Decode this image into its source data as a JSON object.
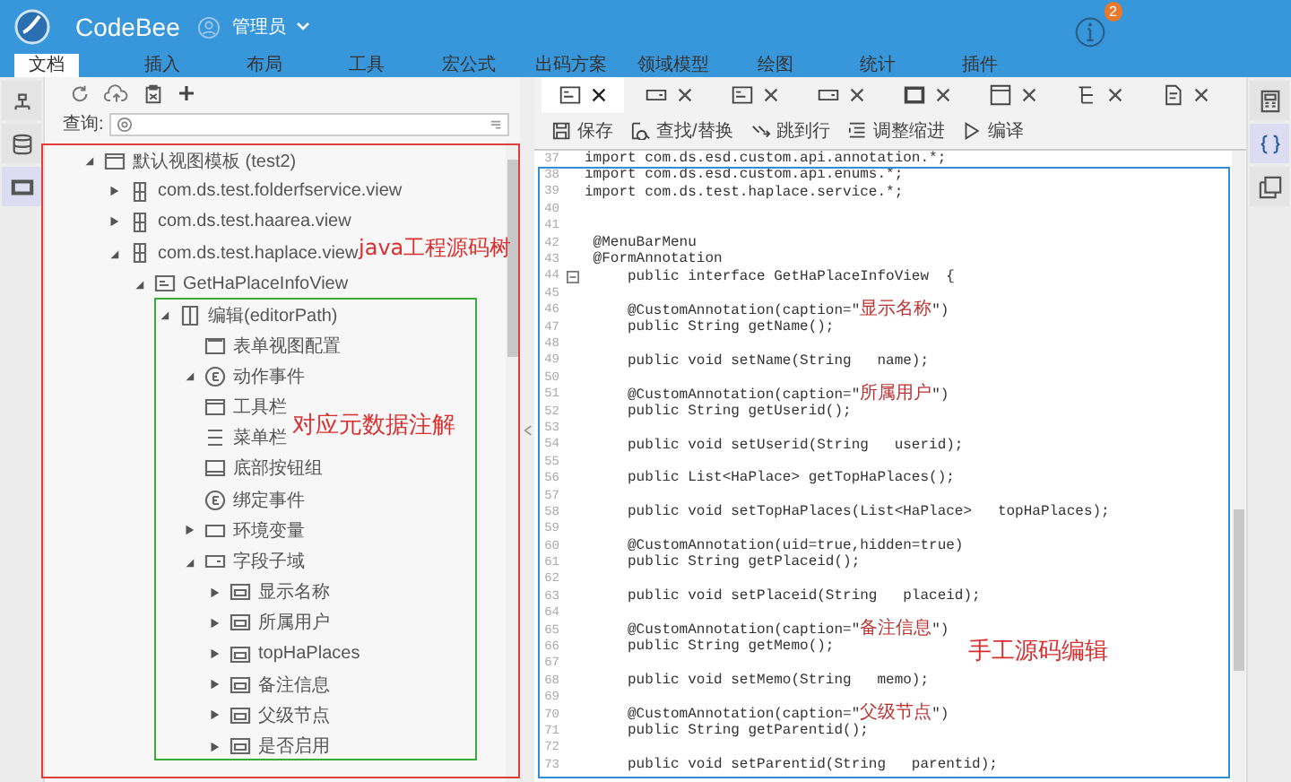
{
  "header": {
    "app_name": "CodeBee",
    "user": "管理员",
    "notification_count": "2"
  },
  "menu_tabs": [
    {
      "label": "文档",
      "selected": true
    },
    {
      "label": "插入",
      "selected": false
    },
    {
      "label": "布局",
      "selected": false
    },
    {
      "label": "工具",
      "selected": false
    },
    {
      "label": "宏公式",
      "selected": false
    },
    {
      "label": "出码方案",
      "selected": false
    },
    {
      "label": "领域模型",
      "selected": false
    },
    {
      "label": "绘图",
      "selected": false
    },
    {
      "label": "统计",
      "selected": false
    },
    {
      "label": "插件",
      "selected": false
    }
  ],
  "left_rail": [
    {
      "kind": "tree",
      "selected": false
    },
    {
      "kind": "database",
      "selected": false
    },
    {
      "kind": "window",
      "selected": true
    }
  ],
  "search": {
    "label": "查询:"
  },
  "tree": [
    {
      "label": "默认视图模板 (test2)",
      "kind": "template",
      "expanded": true,
      "children": [
        {
          "label": "com.ds.test.folderfservice.view",
          "kind": "package",
          "expanded": false
        },
        {
          "label": "com.ds.test.haarea.view",
          "kind": "package",
          "expanded": false
        },
        {
          "label": "com.ds.test.haplace.view",
          "kind": "package",
          "expanded": true,
          "children": [
            {
              "label": "GetHaPlaceInfoView",
              "kind": "view",
              "expanded": true,
              "children": [
                {
                  "label": "编辑(editorPath)",
                  "kind": "editor",
                  "expanded": true,
                  "children": [
                    {
                      "label": "表单视图配置",
                      "kind": "form"
                    },
                    {
                      "label": "动作事件",
                      "kind": "event",
                      "expanded": true
                    },
                    {
                      "label": "工具栏",
                      "kind": "toolbar"
                    },
                    {
                      "label": "菜单栏",
                      "kind": "menubar"
                    },
                    {
                      "label": "底部按钮组",
                      "kind": "buttonbar"
                    },
                    {
                      "label": "绑定事件",
                      "kind": "event"
                    },
                    {
                      "label": "环境变量",
                      "kind": "envvar",
                      "expanded": false
                    },
                    {
                      "label": "字段子域",
                      "kind": "fieldset",
                      "expanded": true,
                      "children": [
                        {
                          "label": "显示名称",
                          "kind": "field",
                          "expanded": false
                        },
                        {
                          "label": "所属用户",
                          "kind": "field",
                          "expanded": false
                        },
                        {
                          "label": "topHaPlaces",
                          "kind": "field",
                          "expanded": false
                        },
                        {
                          "label": "备注信息",
                          "kind": "field",
                          "expanded": false
                        },
                        {
                          "label": "父级节点",
                          "kind": "field",
                          "expanded": false
                        },
                        {
                          "label": "是否启用",
                          "kind": "field",
                          "expanded": false
                        }
                      ]
                    }
                  ]
                }
              ]
            }
          ]
        }
      ]
    }
  ],
  "editor_tabs": [
    {
      "kind": "form",
      "selected": true
    },
    {
      "kind": "field",
      "selected": false
    },
    {
      "kind": "form",
      "selected": false
    },
    {
      "kind": "field",
      "selected": false
    },
    {
      "kind": "panel",
      "selected": false
    },
    {
      "kind": "window",
      "selected": false
    },
    {
      "kind": "tree",
      "selected": false
    },
    {
      "kind": "document",
      "selected": false
    }
  ],
  "editor_toolbar": [
    {
      "label": "保存",
      "kind": "save"
    },
    {
      "label": "查找/替换",
      "kind": "find"
    },
    {
      "label": "跳到行",
      "kind": "goto"
    },
    {
      "label": "调整缩进",
      "kind": "indent"
    },
    {
      "label": "编译",
      "kind": "run"
    }
  ],
  "code_lines": [
    {
      "number": "37",
      "text": "import com.ds.esd.custom.api.annotation.*;",
      "fold": false
    },
    {
      "number": "38",
      "text": "import com.ds.esd.custom.api.enums.*;",
      "fold": false
    },
    {
      "number": "39",
      "text": "import com.ds.test.haplace.service.*;",
      "fold": false
    },
    {
      "number": "40",
      "fold": false
    },
    {
      "number": "41",
      "fold": false
    },
    {
      "number": "42",
      "text": " @MenuBarMenu",
      "fold": false
    },
    {
      "number": "43",
      "text": " @FormAnnotation",
      "fold": false
    },
    {
      "number": "44",
      "text": "     public interface GetHaPlaceInfoView  {",
      "fold": true
    },
    {
      "number": "45",
      "fold": false
    },
    {
      "number": "46",
      "text": "     @CustomAnnotation(caption=\"显示名称\")",
      "fold": false
    },
    {
      "number": "47",
      "text": "     public String getName();",
      "fold": false
    },
    {
      "number": "48",
      "fold": false
    },
    {
      "number": "49",
      "text": "     public void setName(String   name);",
      "fold": false
    },
    {
      "number": "50",
      "fold": false
    },
    {
      "number": "51",
      "text": "     @CustomAnnotation(caption=\"所属用户\")",
      "fold": false
    },
    {
      "number": "52",
      "text": "     public String getUserid();",
      "fold": false
    },
    {
      "number": "53",
      "fold": false
    },
    {
      "number": "54",
      "text": "     public void setUserid(String   userid);",
      "fold": false
    },
    {
      "number": "55",
      "fold": false
    },
    {
      "number": "56",
      "text": "     public List<HaPlace> getTopHaPlaces();",
      "fold": false
    },
    {
      "number": "57",
      "fold": false
    },
    {
      "number": "58",
      "text": "     public void setTopHaPlaces(List<HaPlace>   topHaPlaces);",
      "fold": false
    },
    {
      "number": "59",
      "fold": false
    },
    {
      "number": "60",
      "text": "     @CustomAnnotation(uid=true,hidden=true)",
      "fold": false
    },
    {
      "number": "61",
      "text": "     public String getPlaceid();",
      "fold": false
    },
    {
      "number": "62",
      "fold": false
    },
    {
      "number": "63",
      "text": "     public void setPlaceid(String   placeid);",
      "fold": false
    },
    {
      "number": "64",
      "fold": false
    },
    {
      "number": "65",
      "text": "     @CustomAnnotation(caption=\"备注信息\")",
      "fold": false
    },
    {
      "number": "66",
      "text": "     public String getMemo();",
      "fold": false
    },
    {
      "number": "67",
      "fold": false
    },
    {
      "number": "68",
      "text": "     public void setMemo(String   memo);",
      "fold": false
    },
    {
      "number": "69",
      "fold": false
    },
    {
      "number": "70",
      "text": "     @CustomAnnotation(caption=\"父级节点\")",
      "fold": false
    },
    {
      "number": "71",
      "text": "     public String getParentid();",
      "fold": false
    },
    {
      "number": "72",
      "fold": false
    },
    {
      "number": "73",
      "text": "     public void setParentid(String   parentid);",
      "fold": false
    }
  ],
  "right_rail": [
    {
      "kind": "calculator",
      "selected": false
    },
    {
      "kind": "braces",
      "selected": true
    },
    {
      "kind": "copy",
      "selected": false
    }
  ],
  "annotations": [
    {
      "kind": "tree",
      "label": "java工程源码树",
      "color": "#e03c3c"
    },
    {
      "kind": "metadata",
      "label": "对应元数据注解",
      "color": "#3cab3c"
    },
    {
      "kind": "editor",
      "label": "手工源码编辑",
      "color": "#2f8fd8"
    }
  ]
}
